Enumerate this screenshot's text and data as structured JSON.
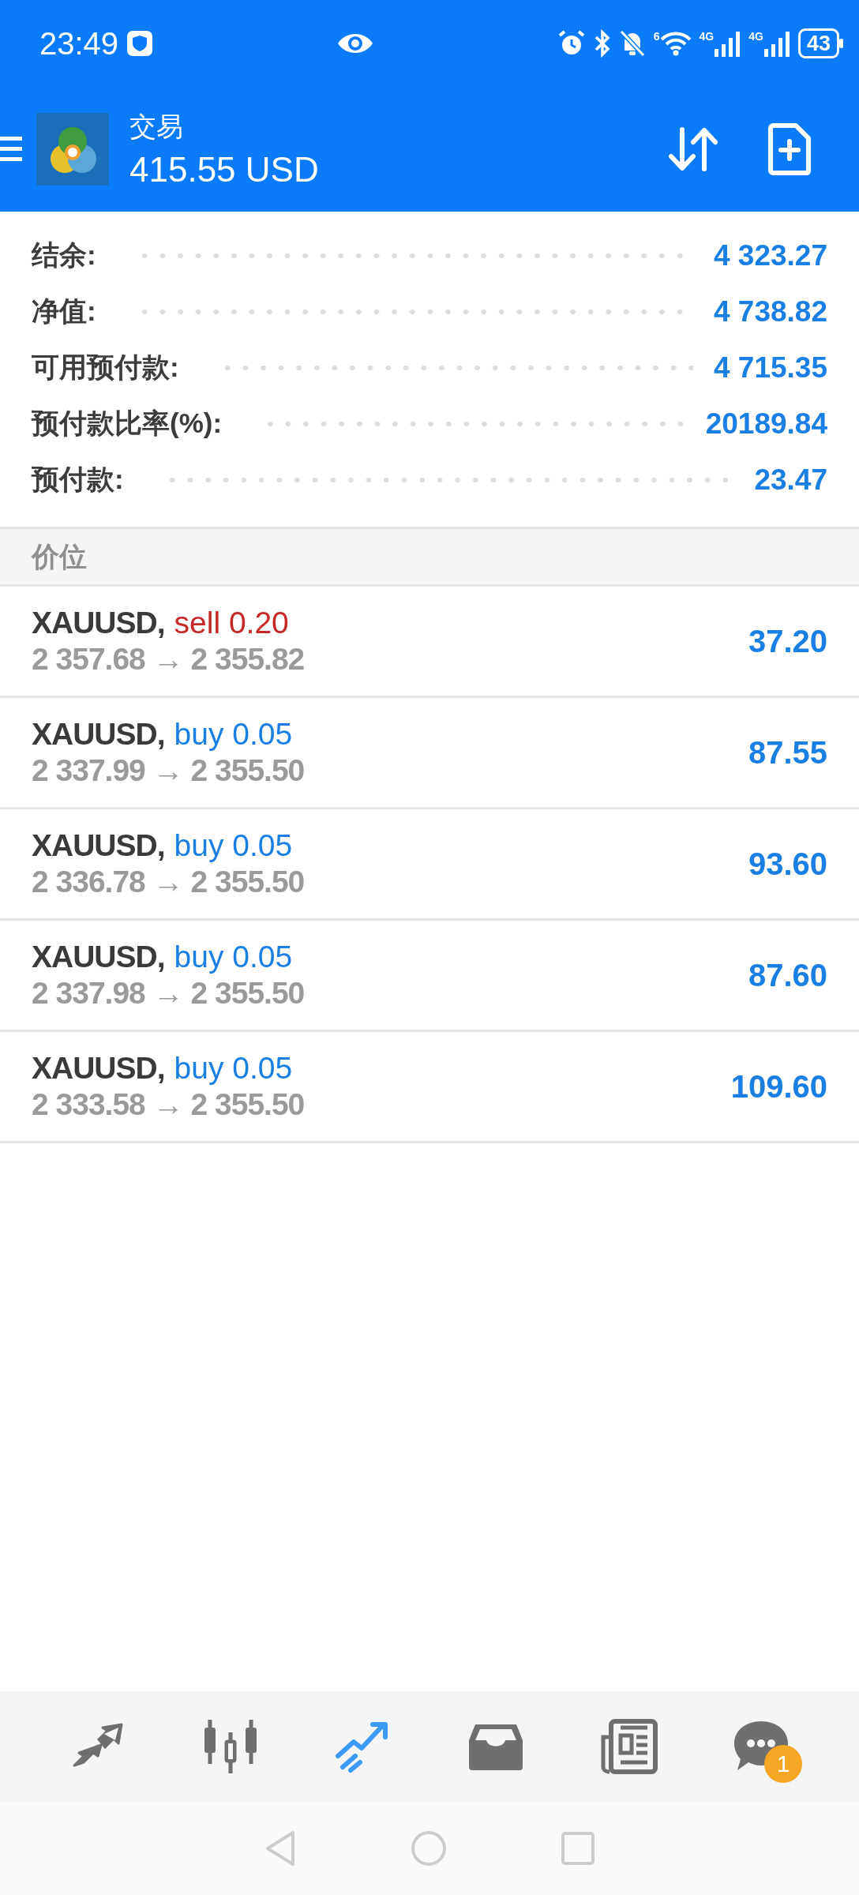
{
  "status_bar": {
    "time": "23:49",
    "wifi_badge": "6",
    "network_labels": [
      "4G",
      "4G"
    ],
    "battery": "43"
  },
  "header": {
    "title": "交易",
    "balance": "415.55 USD"
  },
  "summary": [
    {
      "label": "结余:",
      "value": "4 323.27"
    },
    {
      "label": "净值:",
      "value": "4 738.82"
    },
    {
      "label": "可用预付款:",
      "value": "4 715.35"
    },
    {
      "label": "预付款比率(%):",
      "value": "20189.84"
    },
    {
      "label": "预付款:",
      "value": "23.47"
    }
  ],
  "section_title": "价位",
  "positions": [
    {
      "symbol": "XAUUSD,",
      "kind": "sell",
      "order": "sell 0.20",
      "prices": "2 357.68 → 2 355.82",
      "profit": "37.20"
    },
    {
      "symbol": "XAUUSD,",
      "kind": "buy",
      "order": "buy 0.05",
      "prices": "2 337.99 → 2 355.50",
      "profit": "87.55"
    },
    {
      "symbol": "XAUUSD,",
      "kind": "buy",
      "order": "buy 0.05",
      "prices": "2 336.78 → 2 355.50",
      "profit": "93.60"
    },
    {
      "symbol": "XAUUSD,",
      "kind": "buy",
      "order": "buy 0.05",
      "prices": "2 337.98 → 2 355.50",
      "profit": "87.60"
    },
    {
      "symbol": "XAUUSD,",
      "kind": "buy",
      "order": "buy 0.05",
      "prices": "2 333.58 → 2 355.50",
      "profit": "109.60"
    }
  ],
  "bottom_nav": [
    {
      "kind": "quotes",
      "selected": false
    },
    {
      "kind": "chart",
      "selected": false
    },
    {
      "kind": "trade",
      "selected": true
    },
    {
      "kind": "history",
      "selected": false
    },
    {
      "kind": "news",
      "selected": false
    },
    {
      "kind": "messages",
      "selected": false,
      "badge": "1"
    }
  ]
}
